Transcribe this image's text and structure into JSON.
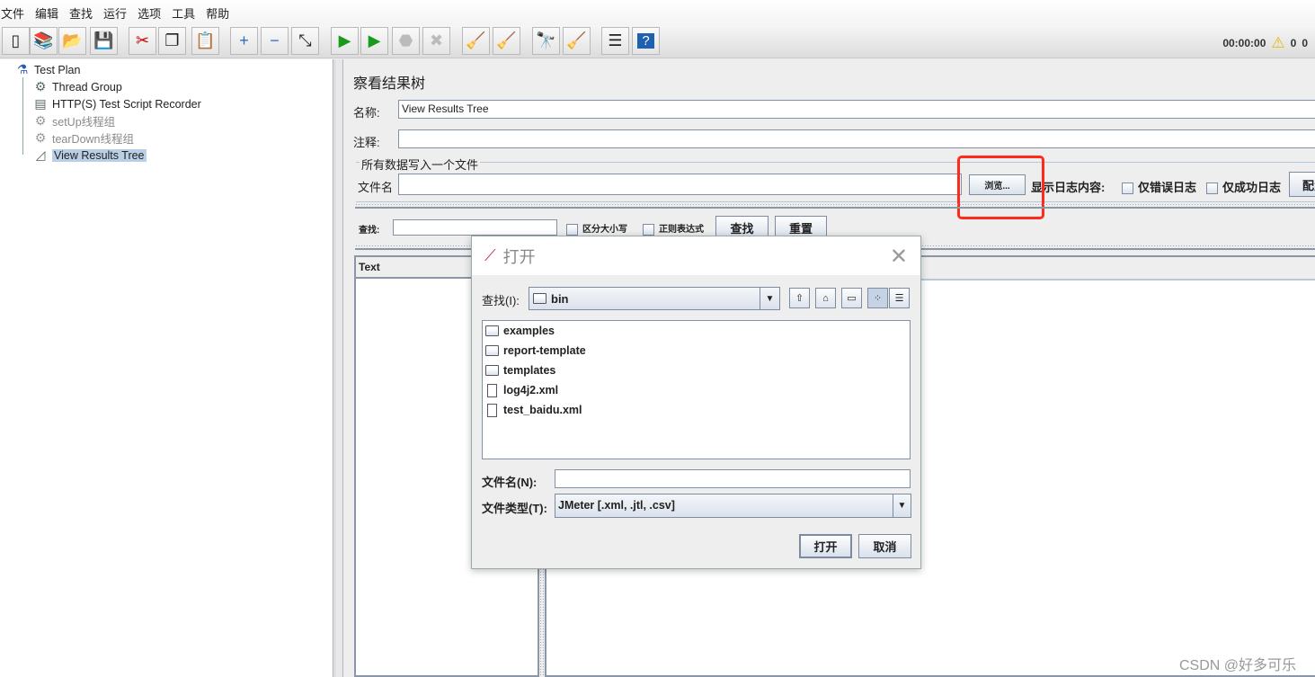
{
  "menu": [
    "文件",
    "编辑",
    "查找",
    "运行",
    "选项",
    "工具",
    "帮助"
  ],
  "toolbar": [
    {
      "icon": "new-icon",
      "glyph": "▯"
    },
    {
      "icon": "templates-icon",
      "glyph": "📚"
    },
    {
      "icon": "open-icon",
      "glyph": "📂"
    },
    {
      "icon": "save-icon",
      "glyph": "💾"
    },
    {
      "icon": "cut-icon",
      "glyph": "✂"
    },
    {
      "icon": "copy-icon",
      "glyph": "❐"
    },
    {
      "icon": "paste-icon",
      "glyph": "📋"
    },
    {
      "icon": "expand-icon",
      "glyph": "+"
    },
    {
      "icon": "collapse-icon",
      "glyph": "−"
    },
    {
      "icon": "toggle-icon",
      "glyph": "⤡"
    },
    {
      "icon": "start-icon",
      "glyph": "▶"
    },
    {
      "icon": "start-no-pause-icon",
      "glyph": "▶"
    },
    {
      "icon": "stop-icon",
      "glyph": "⬣",
      "disabled": true
    },
    {
      "icon": "shutdown-icon",
      "glyph": "✖",
      "disabled": true
    },
    {
      "icon": "clear-icon",
      "glyph": "🧹"
    },
    {
      "icon": "clear-all-icon",
      "glyph": "🧹"
    },
    {
      "icon": "search-icon",
      "glyph": "🔭"
    },
    {
      "icon": "reset-search-icon",
      "glyph": "🧹"
    },
    {
      "icon": "function-helper-icon",
      "glyph": "☰"
    },
    {
      "icon": "help-icon",
      "glyph": "?"
    }
  ],
  "status": {
    "time": "00:00:00",
    "warnings": "0",
    "active": "0"
  },
  "tree": [
    {
      "label": "Test Plan",
      "icon": "flask-icon",
      "glyph": "⚗",
      "level": 0,
      "dim": false,
      "selected": false
    },
    {
      "label": "Thread Group",
      "icon": "gear-icon",
      "glyph": "⚙",
      "level": 1,
      "dim": false,
      "selected": false
    },
    {
      "label": "HTTP(S) Test Script Recorder",
      "icon": "recorder-icon",
      "glyph": "▤",
      "level": 1,
      "dim": false,
      "selected": false
    },
    {
      "label": "setUp线程组",
      "icon": "gear-icon",
      "glyph": "⚙",
      "level": 1,
      "dim": true,
      "selected": false
    },
    {
      "label": "tearDown线程组",
      "icon": "gear-icon",
      "glyph": "⚙",
      "level": 1,
      "dim": true,
      "selected": false
    },
    {
      "label": "View Results Tree",
      "icon": "chart-icon",
      "glyph": "◿",
      "level": 1,
      "dim": false,
      "selected": true
    }
  ],
  "panel": {
    "title": "察看结果树",
    "name_label": "名称:",
    "name_value": "View Results Tree",
    "comment_label": "注释:",
    "comment_value": "",
    "group_title": "所有数据写入一个文件",
    "filename_label": "文件名",
    "filename_value": "",
    "browse": "浏览...",
    "log_label": "显示日志内容:",
    "errors_only": "仅错误日志",
    "success_only": "仅成功日志",
    "configure": "配置",
    "search_label": "查找:",
    "search_value": "",
    "case_sensitive": "区分大小写",
    "regex": "正则表达式",
    "search_button": "查找",
    "reset_button": "重置",
    "text_header": "Text"
  },
  "dialog": {
    "title": "打开",
    "lookin_label": "查找(I):",
    "lookin_value": "bin",
    "files": [
      {
        "name": "examples",
        "type": "folder"
      },
      {
        "name": "report-template",
        "type": "folder"
      },
      {
        "name": "templates",
        "type": "folder"
      },
      {
        "name": "log4j2.xml",
        "type": "file"
      },
      {
        "name": "test_baidu.xml",
        "type": "file"
      }
    ],
    "filename_label": "文件名(N):",
    "filename_value": "",
    "filetype_label": "文件类型(T):",
    "filetype_value": "JMeter [.xml, .jtl, .csv]",
    "open": "打开",
    "cancel": "取消"
  },
  "highlight_color": "#ff2a1a",
  "watermark": "CSDN @好多可乐"
}
